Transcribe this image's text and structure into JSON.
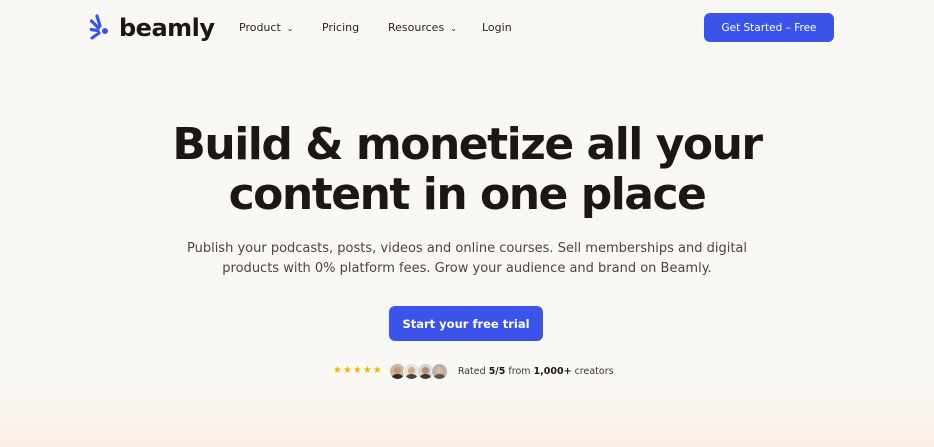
{
  "brand": {
    "name": "beamly",
    "accent": "#3b53e8",
    "logo_icon": "beamly-rays-logo-icon"
  },
  "nav": {
    "items": [
      {
        "label": "Product",
        "has_dropdown": true
      },
      {
        "label": "Pricing",
        "has_dropdown": false
      },
      {
        "label": "Resources",
        "has_dropdown": true
      },
      {
        "label": "Login",
        "has_dropdown": false
      }
    ],
    "cta_label": "Get Started – Free"
  },
  "hero": {
    "headline_line1": "Build & monetize all your",
    "headline_line2": "content in one place",
    "subtitle_line1": "Publish your podcasts, posts, videos and online courses. Sell memberships and digital",
    "subtitle_line2": "products with 0% platform fees. Grow your audience and brand on Beamly.",
    "cta_label": "Start your free trial"
  },
  "social_proof": {
    "stars": 5,
    "star_color": "#f2b600",
    "avatar_count": 4,
    "rated_prefix": "Rated ",
    "rating_value": "5/5",
    "rated_mid": " from ",
    "creators_count": "1,000+",
    "rated_suffix": " creators"
  }
}
